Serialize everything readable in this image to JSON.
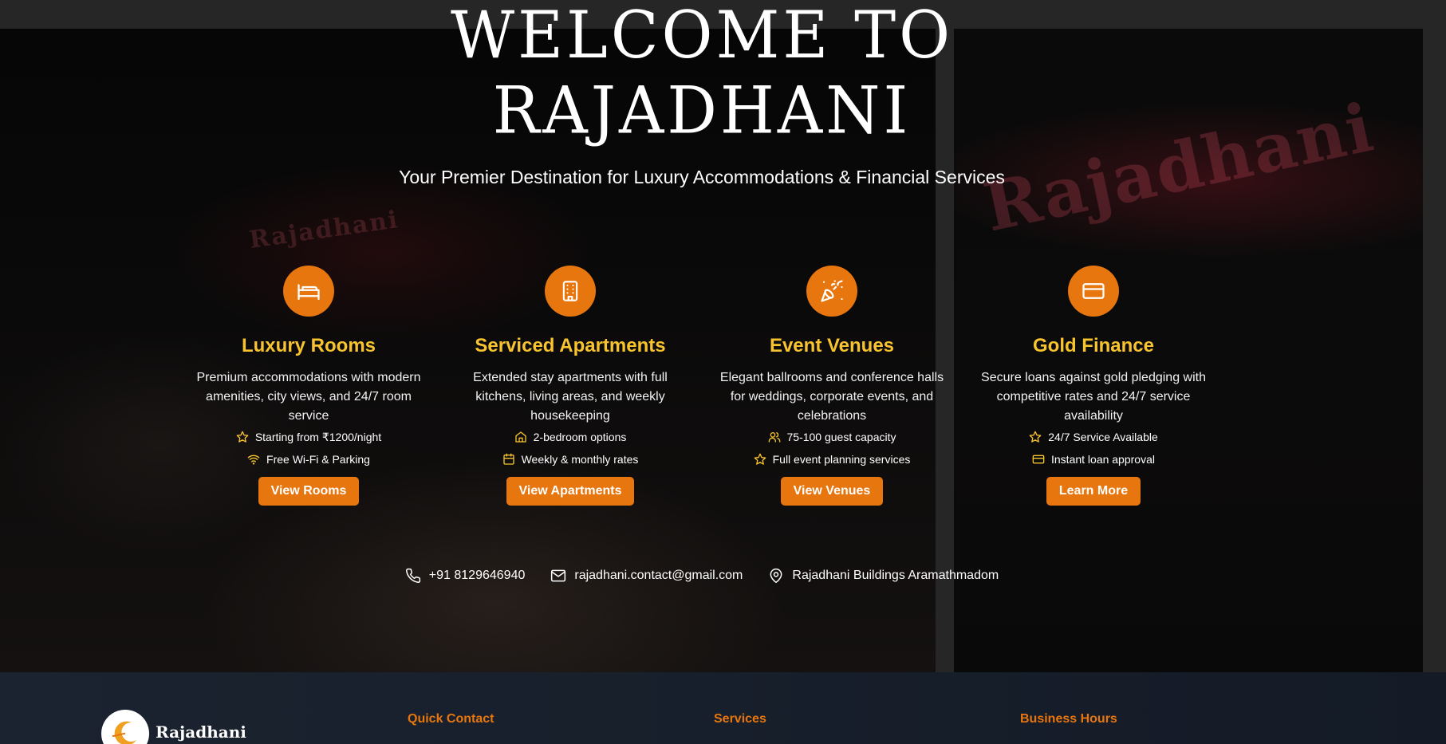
{
  "hero": {
    "title_line1": "WELCOME TO",
    "title_line2": "RAJADHANI",
    "subtitle": "Your Premier Destination for Luxury Accommodations & Financial Services"
  },
  "services": [
    {
      "icon": "bed-icon",
      "title": "Luxury Rooms",
      "description": "Premium accommodations with modern amenities, city views, and 24/7 room service",
      "features": [
        {
          "icon": "star-icon",
          "text": "Starting from ₹1200/night"
        },
        {
          "icon": "wifi-icon",
          "text": "Free Wi-Fi & Parking"
        }
      ],
      "button": "View Rooms"
    },
    {
      "icon": "building-icon",
      "title": "Serviced Apartments",
      "description": "Extended stay apartments with full kitchens, living areas, and weekly housekeeping",
      "features": [
        {
          "icon": "home-icon",
          "text": "2-bedroom options"
        },
        {
          "icon": "calendar-icon",
          "text": "Weekly & monthly rates"
        }
      ],
      "button": "View Apartments"
    },
    {
      "icon": "party-popper-icon",
      "title": "Event Venues",
      "description": "Elegant ballrooms and conference halls for weddings, corporate events, and celebrations",
      "features": [
        {
          "icon": "users-icon",
          "text": "75-100 guest capacity"
        },
        {
          "icon": "star-icon",
          "text": "Full event planning services"
        }
      ],
      "button": "View Venues"
    },
    {
      "icon": "credit-card-icon",
      "title": "Gold Finance",
      "description": "Secure loans against gold pledging with competitive rates and 24/7 service availability",
      "features": [
        {
          "icon": "star-icon",
          "text": "24/7 Service Available"
        },
        {
          "icon": "credit-card-icon",
          "text": "Instant loan approval"
        }
      ],
      "button": "Learn More"
    }
  ],
  "contact": {
    "phone": "+91 8129646940",
    "email": "rajadhani.contact@gmail.com",
    "address": "Rajadhani Buildings Aramathmadom"
  },
  "footer": {
    "brand": "Rajadhani",
    "headings": [
      "Quick Contact",
      "Services",
      "Business Hours"
    ]
  },
  "colors": {
    "accent": "#e8760f",
    "title_gold": "#f7c32e",
    "footer_bg": "#1b2330"
  }
}
